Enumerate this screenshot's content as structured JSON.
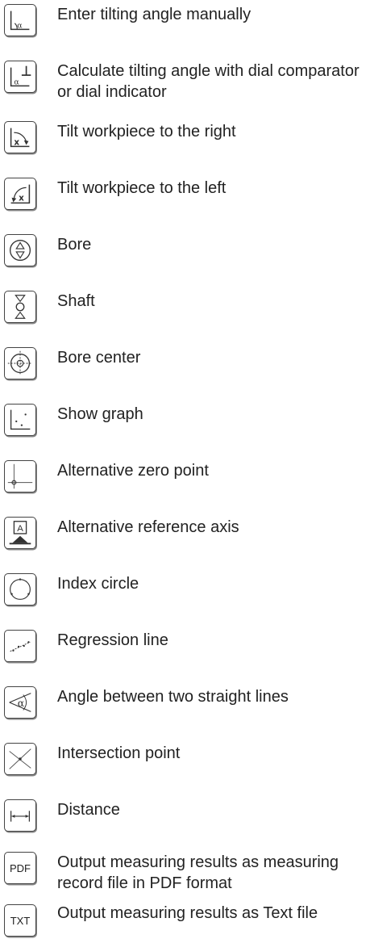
{
  "items": [
    {
      "icon": "tilt-angle-manual-icon",
      "label": "Enter tilting angle manually"
    },
    {
      "icon": "tilt-angle-dial-icon",
      "label": "Calculate tilting angle with dial comparator or dial indicator"
    },
    {
      "icon": "tilt-right-icon",
      "label": "Tilt workpiece to the right"
    },
    {
      "icon": "tilt-left-icon",
      "label": "Tilt workpiece to the left"
    },
    {
      "icon": "bore-icon",
      "label": "Bore"
    },
    {
      "icon": "shaft-icon",
      "label": "Shaft"
    },
    {
      "icon": "bore-center-icon",
      "label": "Bore center"
    },
    {
      "icon": "graph-icon",
      "label": "Show graph"
    },
    {
      "icon": "zero-point-icon",
      "label": "Alternative zero point"
    },
    {
      "icon": "reference-axis-icon",
      "label": "Alternative reference axis",
      "icon_text": "A"
    },
    {
      "icon": "index-circle-icon",
      "label": "Index circle"
    },
    {
      "icon": "regression-line-icon",
      "label": "Regression line"
    },
    {
      "icon": "angle-lines-icon",
      "label": "Angle between two straight lines",
      "icon_text": "α"
    },
    {
      "icon": "intersection-point-icon",
      "label": "Intersection point"
    },
    {
      "icon": "distance-icon",
      "label": "Distance"
    },
    {
      "icon": "pdf-icon",
      "label": "Output measuring results as measuring record file in PDF format",
      "icon_text": "PDF"
    },
    {
      "icon": "txt-icon",
      "label": "Output measuring results as Text file",
      "icon_text": "TXT"
    }
  ]
}
